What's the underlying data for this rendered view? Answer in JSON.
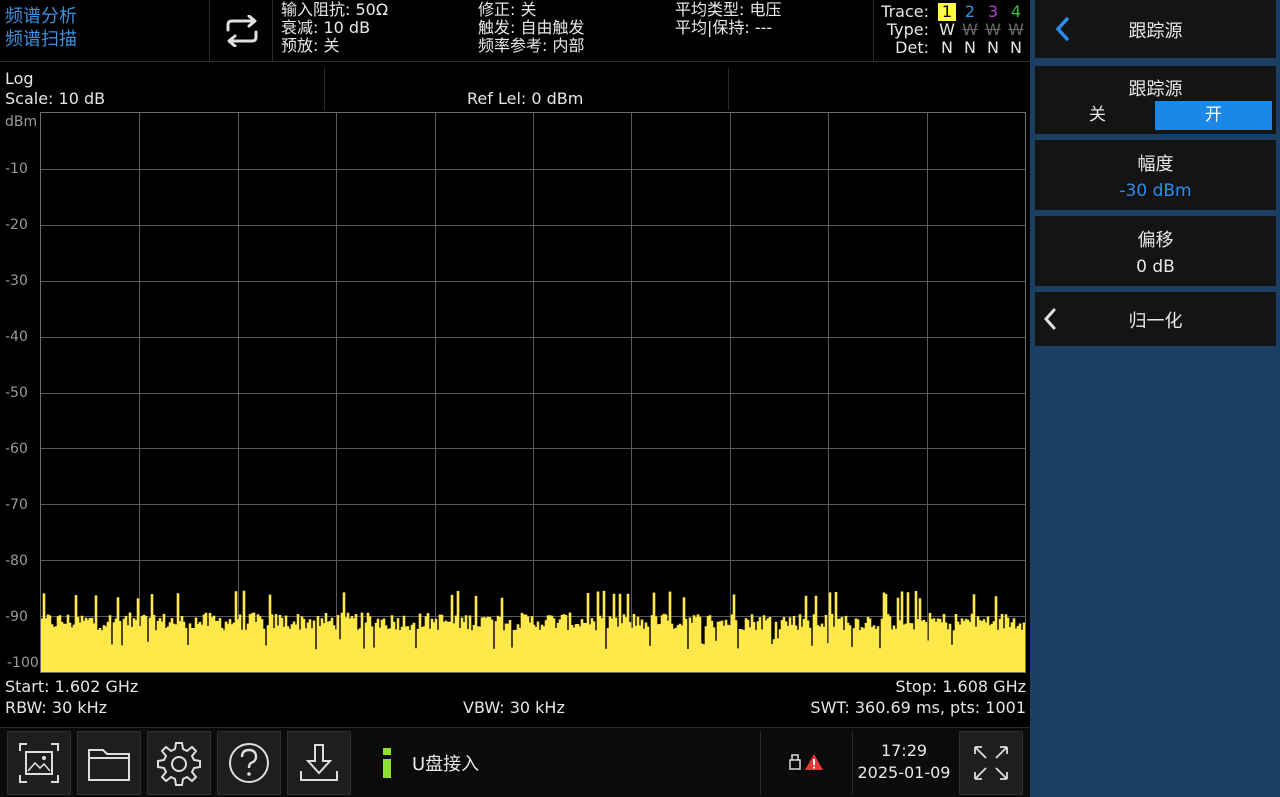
{
  "mode": {
    "line1": "频谱分析",
    "line2": "频谱扫描"
  },
  "status": {
    "col1": [
      "输入阻抗: 50Ω",
      "衰减: 10 dB",
      "预放: 关"
    ],
    "col2": [
      "修正: 关",
      "触发: 自由触发",
      "频率参考: 内部"
    ],
    "col3": [
      "平均类型: 电压",
      "平均|保持: ---"
    ]
  },
  "traces": {
    "trace_label": "Trace:",
    "type_label": "Type:",
    "det_label": "Det:",
    "numbers": [
      "1",
      "2",
      "3",
      "4"
    ],
    "number_colors": [
      "#000000",
      "#3d8fe0",
      "#b040d0",
      "#3cc03c"
    ],
    "active_highlight": "#ffff3c",
    "types": [
      "W",
      "W",
      "W",
      "W"
    ],
    "dets": [
      "N",
      "N",
      "N",
      "N"
    ]
  },
  "scale": {
    "mode": "Log",
    "scale": "Scale: 10 dB",
    "ref": "Ref Lel: 0 dBm",
    "unit": "dBm"
  },
  "yaxis_labels": [
    "-10",
    "-20",
    "-30",
    "-40",
    "-50",
    "-60",
    "-70",
    "-80",
    "-90",
    "-100"
  ],
  "chart_data": {
    "type": "area",
    "ylabel": "dBm",
    "ylim": [
      -100,
      0
    ],
    "x_range_ghz": [
      1.602,
      1.608
    ],
    "points": 1001,
    "noise_floor_dbm": -91,
    "noise_peak_dbm": -87,
    "series": [
      {
        "color": "#ffe84a"
      }
    ],
    "grid": true,
    "grid_divisions": {
      "x": 10,
      "y": 10
    }
  },
  "bottom": {
    "start": "Start: 1.602 GHz",
    "stop": "Stop: 1.608 GHz",
    "rbw": "RBW: 30 kHz",
    "vbw": "VBW: 30 kHz",
    "swt": "SWT: 360.69 ms, pts: 1001"
  },
  "taskbar": {
    "buttons": [
      "screenshot-icon",
      "folder-icon",
      "settings-gear-icon",
      "help-icon",
      "download-icon"
    ],
    "notice": "U盘接入",
    "time": "17:29",
    "date": "2025-01-09"
  },
  "panel": {
    "header": "跟踪源",
    "source": {
      "title": "跟踪源",
      "off": "关",
      "on": "开",
      "selected": "on"
    },
    "amplitude": {
      "title": "幅度",
      "value": "-30 dBm"
    },
    "offset": {
      "title": "偏移",
      "value": "0 dB"
    },
    "normalize": {
      "title": "归一化"
    },
    "accent": "#1b88e8"
  }
}
